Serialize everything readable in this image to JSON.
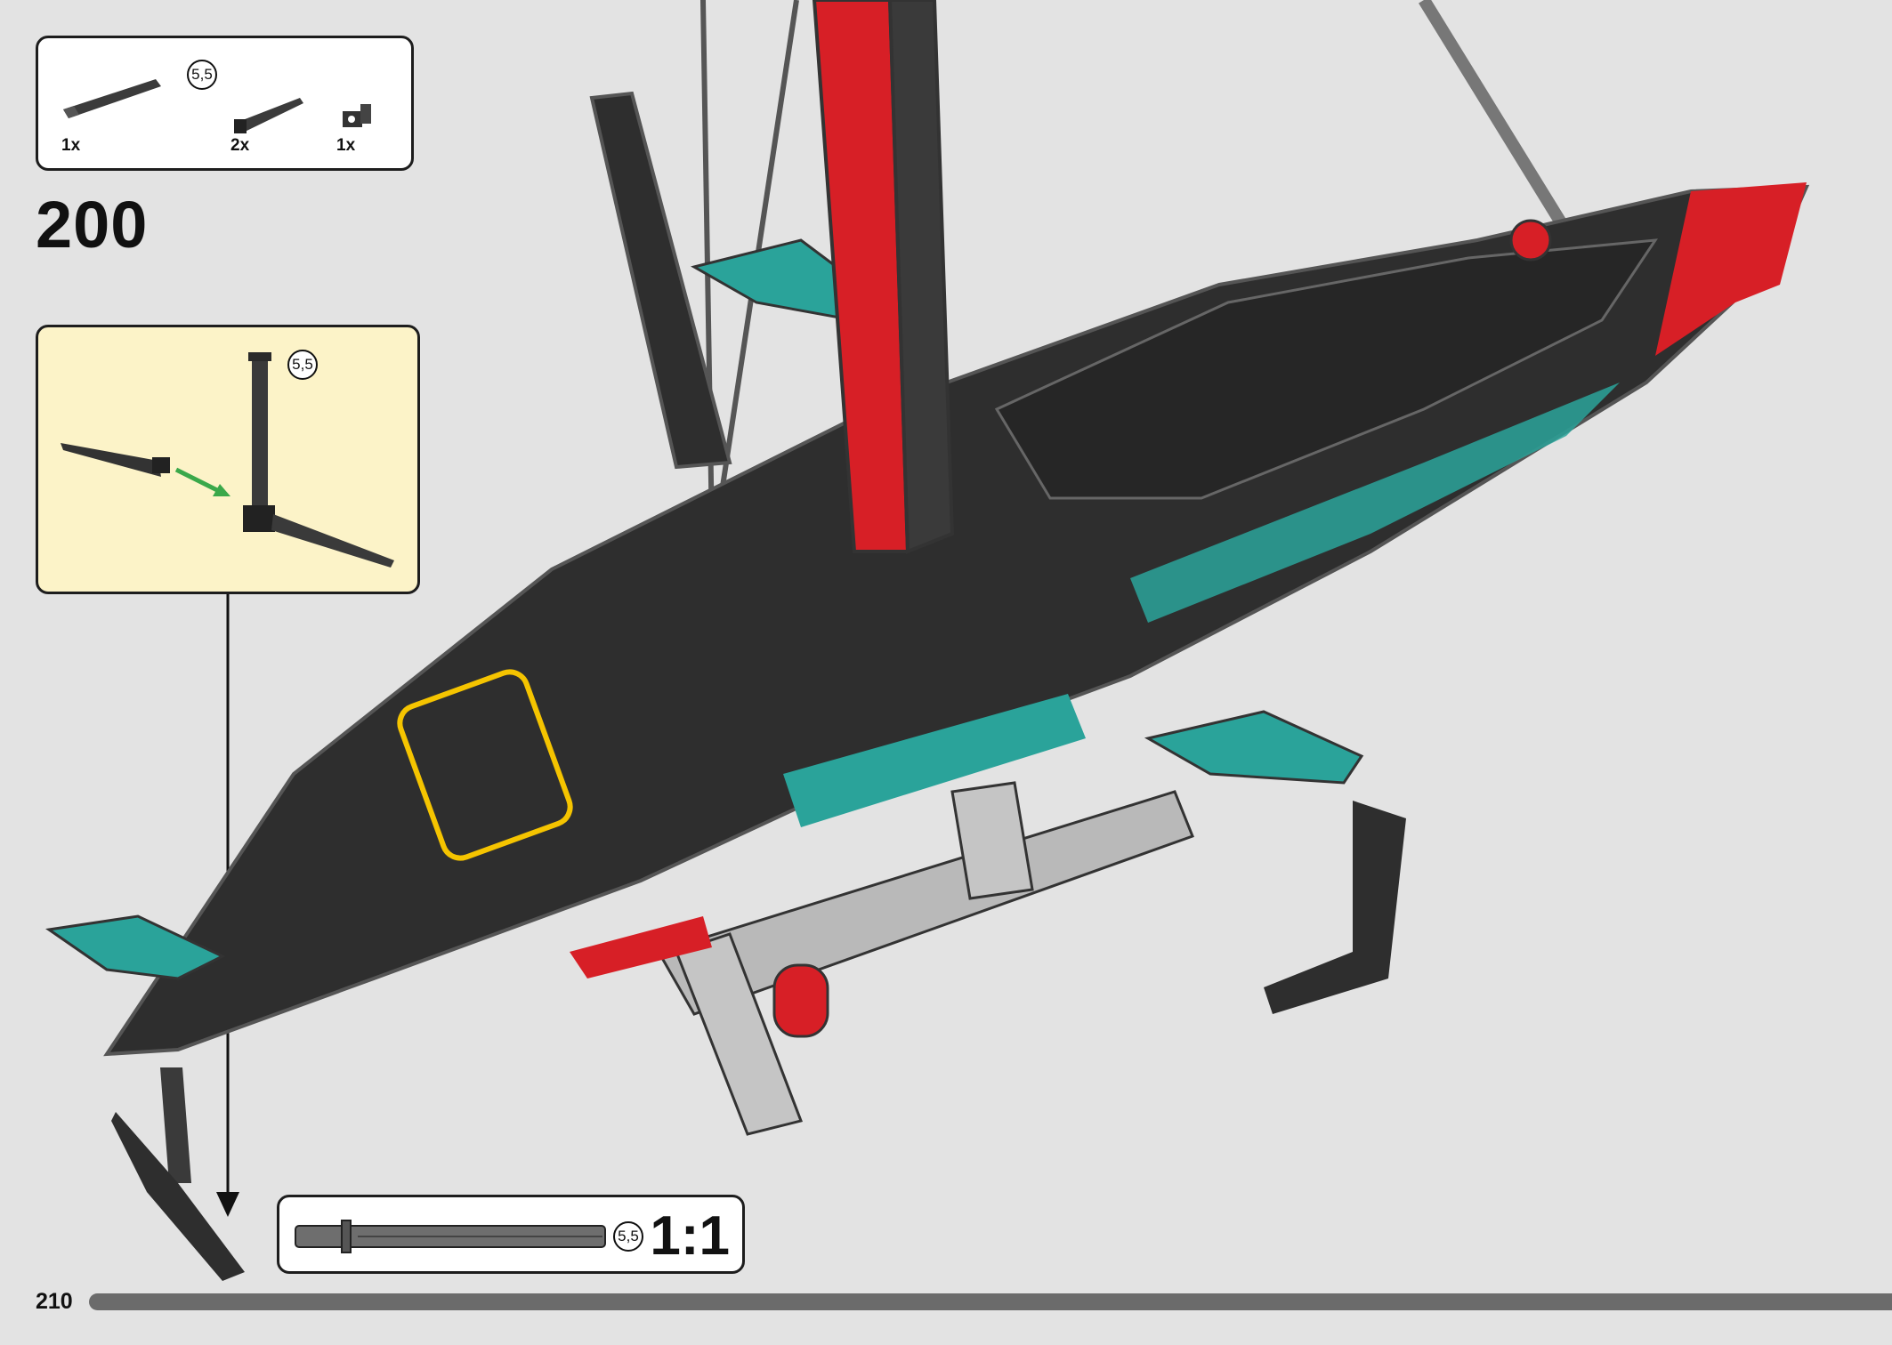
{
  "step": {
    "number": "200"
  },
  "parts": [
    {
      "qty": "1x",
      "part": "axle-5.5-with-stop",
      "length_badge": "5,5"
    },
    {
      "qty": "2x",
      "part": "tapered-foil-element"
    },
    {
      "qty": "1x",
      "part": "axle-connector-hub"
    }
  ],
  "sub_step": {
    "length_badge": "5,5",
    "arrow_color": "#3aa84a"
  },
  "scale_check": {
    "length_badge": "5,5",
    "ratio": "1:1"
  },
  "page": {
    "number": "210"
  },
  "colors": {
    "hull_black": "#2e2e2e",
    "accent_teal": "#2aa39a",
    "accent_red": "#d71f26",
    "beam_grey": "#b9b9b9",
    "highlight_yellow": "#f5c400"
  }
}
